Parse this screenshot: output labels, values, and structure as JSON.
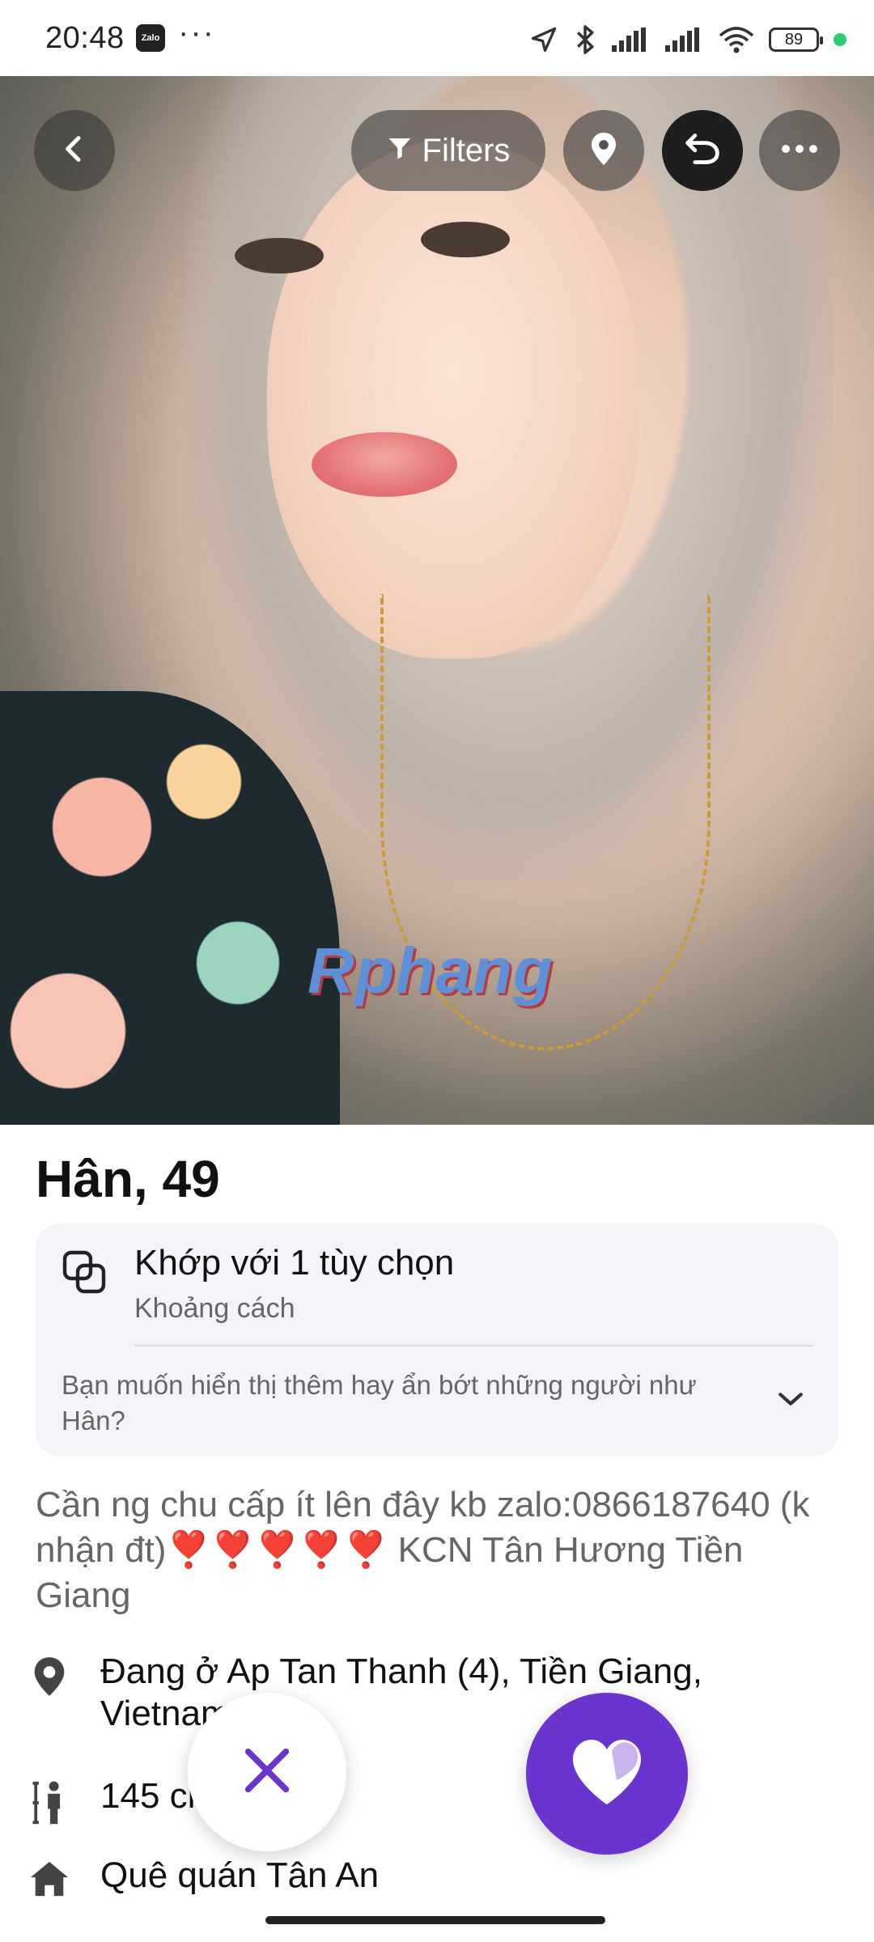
{
  "status_bar": {
    "time": "20:48",
    "zalo_label": "Zalo",
    "more_dots": "···",
    "battery": "89"
  },
  "toolbar": {
    "filters_label": "Filters"
  },
  "photo": {
    "watermark": "Rphang"
  },
  "profile": {
    "name_age": "Hân, 49",
    "match": {
      "title": "Khớp với 1 tùy chọn",
      "subtitle": "Khoảng cách",
      "question": "Bạn muốn hiển thị thêm hay ẩn bớt những người như Hân?"
    },
    "bio": "Cần ng chu cấp ít lên đây kb zalo:0866187640 (k nhận đt)❣️❣️❣️❣️❣️ KCN Tân Hương Tiền Giang",
    "location": "Đang ở Ap Tan Thanh (4), Tiền Giang, Vietnam",
    "height": "145 cm",
    "hometown": "Quê quán Tân An"
  },
  "colors": {
    "accent": "#6a35cf",
    "card_bg": "#f3f4f7"
  }
}
